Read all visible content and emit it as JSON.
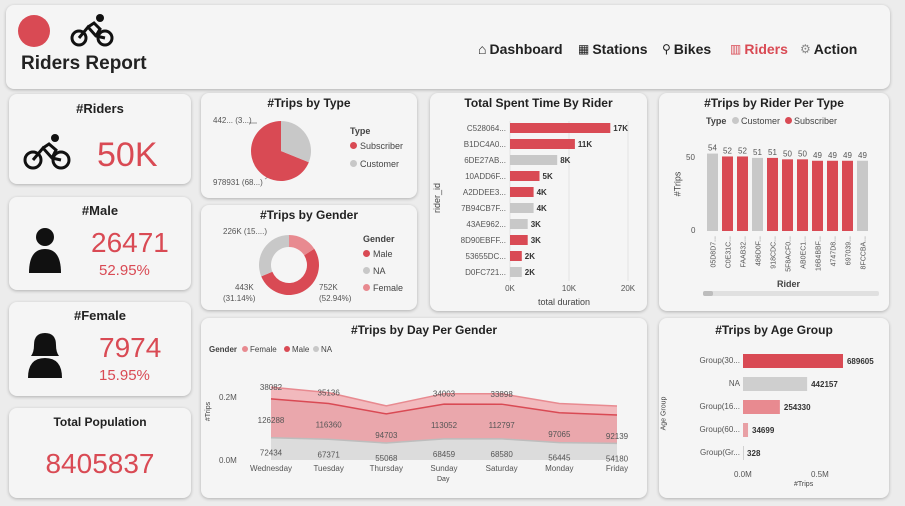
{
  "header": {
    "title": "Riders Report",
    "nav": [
      {
        "label": "Dashboard",
        "icon": "home-icon"
      },
      {
        "label": "Stations",
        "icon": "station-icon"
      },
      {
        "label": "Bikes",
        "icon": "bike-icon"
      },
      {
        "label": "Riders",
        "icon": "riders-icon",
        "active": true
      },
      {
        "label": "Action",
        "icon": "action-icon"
      }
    ]
  },
  "colors": {
    "accent": "#d94a54",
    "grey": "#c8c8c8",
    "light_red": "#e88a90"
  },
  "kpis": {
    "riders": {
      "title": "#Riders",
      "value": "50K"
    },
    "male": {
      "title": "#Male",
      "value": "26471",
      "pct": "52.95%"
    },
    "female": {
      "title": "#Female",
      "value": "7974",
      "pct": "15.95%"
    },
    "population": {
      "title": "Total Population",
      "value": "8405837"
    }
  },
  "trips_by_type": {
    "title": "#Trips by Type",
    "legend_title": "Type",
    "legend": [
      "Subscriber",
      "Customer"
    ],
    "label_top": "442... (3...)",
    "label_bottom": "978931 (68...)",
    "chart_data": {
      "type": "pie",
      "categories": [
        "Subscriber",
        "Customer"
      ],
      "values": [
        978931,
        442000
      ]
    }
  },
  "trips_by_gender": {
    "title": "#Trips by Gender",
    "legend_title": "Gender",
    "legend": [
      "Male",
      "NA",
      "Female"
    ],
    "label_top": "226K (15....)",
    "label_left_1": "443K",
    "label_left_2": "(31.14%)",
    "label_right_1": "752K",
    "label_right_2": "(52.94%)",
    "chart_data": {
      "type": "pie",
      "categories": [
        "Male",
        "NA",
        "Female"
      ],
      "values": [
        752000,
        443000,
        226000
      ]
    }
  },
  "spent_time": {
    "title": "Total Spent Time By Rider",
    "ylabel": "rider_id",
    "xlabel": "total duration",
    "chart_data": {
      "type": "bar",
      "categories": [
        "C528064...",
        "B1DC4A0...",
        "6DE27AB...",
        "10ADD6F...",
        "A2DDEE3...",
        "7B94CB7F...",
        "43AE962...",
        "8D90EBFF...",
        "53655DC...",
        "D0FC721..."
      ],
      "values": [
        17,
        11,
        8,
        5,
        4,
        4,
        3,
        3,
        2,
        2
      ],
      "labels": [
        "17K",
        "11K",
        "8K",
        "5K",
        "4K",
        "4K",
        "3K",
        "3K",
        "2K",
        "2K"
      ],
      "series_type": [
        "Subscriber",
        "Subscriber",
        "Customer",
        "Subscriber",
        "Subscriber",
        "Customer",
        "Customer",
        "Subscriber",
        "Subscriber",
        "Customer"
      ],
      "xticks": [
        "0K",
        "10K",
        "20K"
      ],
      "xlim": [
        0,
        20
      ]
    }
  },
  "per_type": {
    "title": "#Trips by Rider Per Type",
    "legend_title": "Type",
    "legend": [
      "Customer",
      "Subscriber"
    ],
    "ylabel": "#Trips",
    "xlabel": "Rider",
    "yticks": [
      "50",
      "0"
    ],
    "chart_data": {
      "type": "bar",
      "categories": [
        "05D8D7...",
        "C0E31C...",
        "FAAB32...",
        "486D0F...",
        "918CDC...",
        "5F8ACF0...",
        "AB0EC1...",
        "16B4BBF...",
        "4747D8...",
        "697039...",
        "8FCCBA..."
      ],
      "values": [
        54,
        52,
        52,
        51,
        51,
        50,
        50,
        49,
        49,
        49,
        49
      ],
      "series_type": [
        "Customer",
        "Subscriber",
        "Subscriber",
        "Customer",
        "Subscriber",
        "Subscriber",
        "Subscriber",
        "Subscriber",
        "Subscriber",
        "Subscriber",
        "Customer"
      ],
      "ylim": [
        0,
        60
      ]
    }
  },
  "by_day": {
    "title": "#Trips by Day Per Gender",
    "legend_title": "Gender",
    "legend": [
      "Female",
      "Male",
      "NA"
    ],
    "ylabel": "#Trips",
    "xlabel": "Day",
    "yticks": [
      "0.2M",
      "0.0M"
    ],
    "chart_data": {
      "type": "area",
      "categories": [
        "Wednesday",
        "Tuesday",
        "Thursday",
        "Sunday",
        "Saturday",
        "Monday",
        "Friday"
      ],
      "series": [
        {
          "name": "Female",
          "values": [
            38082,
            35136,
            26000,
            34003,
            33898,
            30000,
            29000
          ]
        },
        {
          "name": "Male",
          "values": [
            126288,
            116360,
            94703,
            113052,
            112797,
            97065,
            92139
          ]
        },
        {
          "name": "NA",
          "values": [
            72434,
            67371,
            55068,
            68459,
            68580,
            56445,
            54180
          ]
        }
      ],
      "labels": {
        "Female": [
          "38082",
          "35136",
          "",
          "34003",
          "33898",
          "",
          ""
        ],
        "Male": [
          "126288",
          "116360",
          "94703",
          "113052",
          "112797",
          "97065",
          "92139"
        ],
        "NA": [
          "72434",
          "67371",
          "55068",
          "68459",
          "68580",
          "56445",
          "54180"
        ]
      },
      "ylim": [
        0,
        260000
      ]
    }
  },
  "age_group": {
    "title": "#Trips by Age Group",
    "ylabel": "Age Group",
    "xlabel": "#Trips",
    "xticks": [
      "0.0M",
      "0.5M"
    ],
    "chart_data": {
      "type": "bar",
      "categories": [
        "Group(30...",
        "NA",
        "Group(16...",
        "Group(60...",
        "Group(Gr..."
      ],
      "values": [
        689605,
        442157,
        254330,
        34699,
        328
      ],
      "labels": [
        "689605",
        "442157",
        "254330",
        "34699",
        "328"
      ],
      "xlim": [
        0,
        800000
      ]
    }
  }
}
